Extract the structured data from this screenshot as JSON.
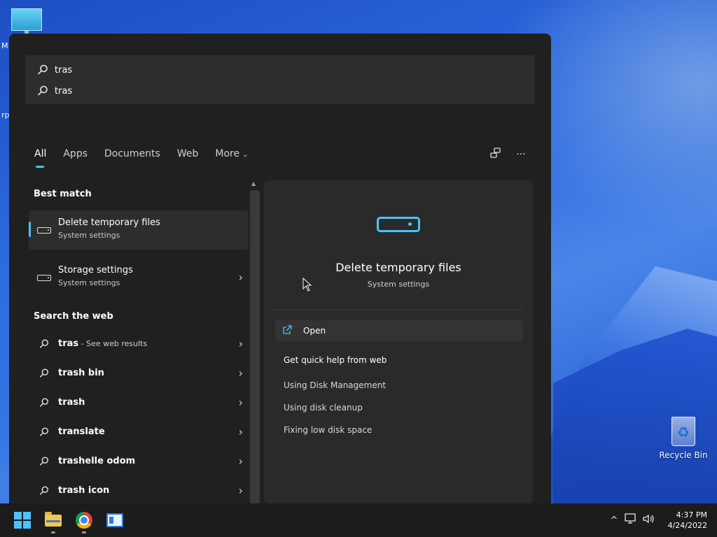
{
  "desktop": {
    "left_edge_text_top": "M",
    "left_edge_text_mid": "rp",
    "recycle_bin_label": "Recycle Bin"
  },
  "search": {
    "query": "tras",
    "suggestion": "tras"
  },
  "tabs": [
    {
      "label": "All",
      "active": true
    },
    {
      "label": "Apps"
    },
    {
      "label": "Documents"
    },
    {
      "label": "Web"
    },
    {
      "label": "More"
    }
  ],
  "tools": {
    "share_icon": "share-icon",
    "more_icon": "ellipsis-icon",
    "more_glyph": "···"
  },
  "results": {
    "best_match_title": "Best match",
    "best_match": [
      {
        "title": "Delete temporary files",
        "subtitle": "System settings",
        "icon": "drive-icon",
        "selected": true
      },
      {
        "title": "Storage settings",
        "subtitle": "System settings",
        "icon": "drive-icon"
      }
    ],
    "web_title": "Search the web",
    "web": [
      {
        "label": "tras",
        "suffix": " - See web results"
      },
      {
        "label": "trash bin"
      },
      {
        "label": "trash"
      },
      {
        "label": "translate"
      },
      {
        "label": "trashelle odom"
      },
      {
        "label": "trash icon"
      }
    ],
    "chevron": "›"
  },
  "preview": {
    "title": "Delete temporary files",
    "subtitle": "System settings",
    "open_label": "Open",
    "help_title": "Get quick help from web",
    "help_links": [
      "Using Disk Management",
      "Using disk cleanup",
      "Fixing low disk space"
    ]
  },
  "taskbar": {
    "apps": [
      "start-button",
      "file-explorer",
      "chrome",
      "app-window"
    ],
    "tray_chevron": "^",
    "time": "4:37 PM",
    "date": "4/24/2022"
  },
  "colors": {
    "accent": "#4cc2ff",
    "panel": "#202020",
    "taskbar": "#1c1c1c"
  }
}
